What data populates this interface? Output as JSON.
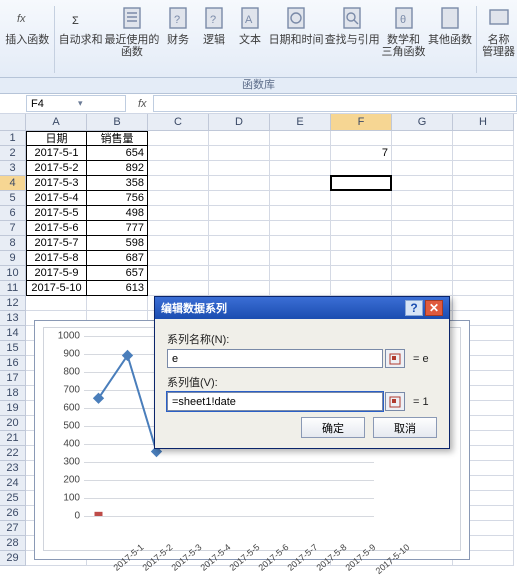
{
  "ribbon": {
    "insert_fn": "插入函数",
    "autosum": "自动求和",
    "recent": "最近使用的\n函数",
    "finance": "财务",
    "logic": "逻辑",
    "text": "文本",
    "datetime": "日期和时间",
    "lookup": "查找与引用",
    "math": "数学和\n三角函数",
    "other": "其他函数",
    "names": "名称\n管理器",
    "group_caption": "函数库"
  },
  "namebox": "F4",
  "formula_label": "fx",
  "columns": [
    "A",
    "B",
    "C",
    "D",
    "E",
    "F",
    "G",
    "H"
  ],
  "active_col": "F",
  "active_row": 4,
  "row_count": 29,
  "headers": {
    "date": "日期",
    "sales": "销售量"
  },
  "table": [
    {
      "date": "2017-5-1",
      "sales": 654
    },
    {
      "date": "2017-5-2",
      "sales": 892
    },
    {
      "date": "2017-5-3",
      "sales": 358
    },
    {
      "date": "2017-5-4",
      "sales": 756
    },
    {
      "date": "2017-5-5",
      "sales": 498
    },
    {
      "date": "2017-5-6",
      "sales": 777
    },
    {
      "date": "2017-5-7",
      "sales": 598
    },
    {
      "date": "2017-5-8",
      "sales": 687
    },
    {
      "date": "2017-5-9",
      "sales": 657
    },
    {
      "date": "2017-5-10",
      "sales": 613
    }
  ],
  "cell_F2": "7",
  "chart_data": {
    "type": "line",
    "title": "",
    "xlabel": "",
    "ylabel": "",
    "ylim": [
      0,
      1000
    ],
    "yticks": [
      0,
      100,
      200,
      300,
      400,
      500,
      600,
      700,
      800,
      900,
      1000
    ],
    "categories": [
      "2017-5-1",
      "2017-5-2",
      "2017-5-3",
      "2017-5-4",
      "2017-5-5",
      "2017-5-6",
      "2017-5-7",
      "2017-5-8",
      "2017-5-9",
      "2017-5-10"
    ],
    "series": [
      {
        "name": "销售量",
        "values": [
          654,
          892,
          358,
          null,
          null,
          null,
          null,
          null,
          null,
          null
        ],
        "color": "#4a7ebb"
      },
      {
        "name": "e",
        "values": [
          1,
          null,
          null,
          null,
          null,
          null,
          null,
          null,
          null,
          null
        ],
        "color": "#be4b48"
      }
    ]
  },
  "dialog": {
    "title": "编辑数据系列",
    "name_label": "系列名称(N):",
    "name_value": "e",
    "name_result": "= e",
    "value_label": "系列值(V):",
    "value_value": "=sheet1!date",
    "value_result": "= 1",
    "ok": "确定",
    "cancel": "取消"
  }
}
